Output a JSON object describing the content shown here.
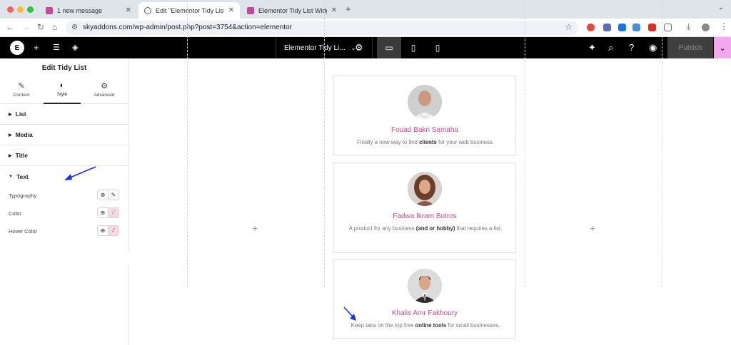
{
  "browser": {
    "tabs": [
      {
        "title": "1 new message",
        "favicon_color": "#c8479a"
      },
      {
        "title": "Edit \"Elementor Tidy List Wid",
        "favicon_color": "#555555"
      },
      {
        "title": "Elementor Tidy List Widget -",
        "favicon_color": "#c8479a"
      }
    ],
    "url": "skyaddons.com/wp-admin/post.php?post=3754&action=elementor"
  },
  "topbar": {
    "document_title": "Elementor Tidy Li...",
    "publish_label": "Publish"
  },
  "panel": {
    "title": "Edit Tidy List",
    "tabs": [
      {
        "label": "Content",
        "icon": "pencil-icon"
      },
      {
        "label": "Style",
        "icon": "contrast-icon"
      },
      {
        "label": "Advanced",
        "icon": "gear-icon"
      }
    ],
    "sections": [
      {
        "label": "List",
        "expanded": false
      },
      {
        "label": "Media",
        "expanded": false
      },
      {
        "label": "Title",
        "expanded": false
      },
      {
        "label": "Text",
        "expanded": true
      }
    ],
    "controls": [
      {
        "label": "Typography"
      },
      {
        "label": "Color"
      },
      {
        "label": "Hover Color"
      }
    ]
  },
  "cards": [
    {
      "name": "Fouad Bakri Samaha",
      "desc_before": "Finally a new way to find ",
      "desc_bold": "clients",
      "desc_after": " for your web business."
    },
    {
      "name": "Fadwa Ikram Botros",
      "desc_before": "A product for any business ",
      "desc_bold": "(and or hobby)",
      "desc_after": " that requires a list."
    },
    {
      "name": "Khalis Amr Fakhoury",
      "desc_before": "Keep tabs on the top free ",
      "desc_bold": "online tools",
      "desc_after": " for small businesses."
    }
  ],
  "colors": {
    "accent_pink": "#d0498a",
    "annotation_arrow": "#1a33e6",
    "publish_dropdown": "#f2a8ee"
  }
}
